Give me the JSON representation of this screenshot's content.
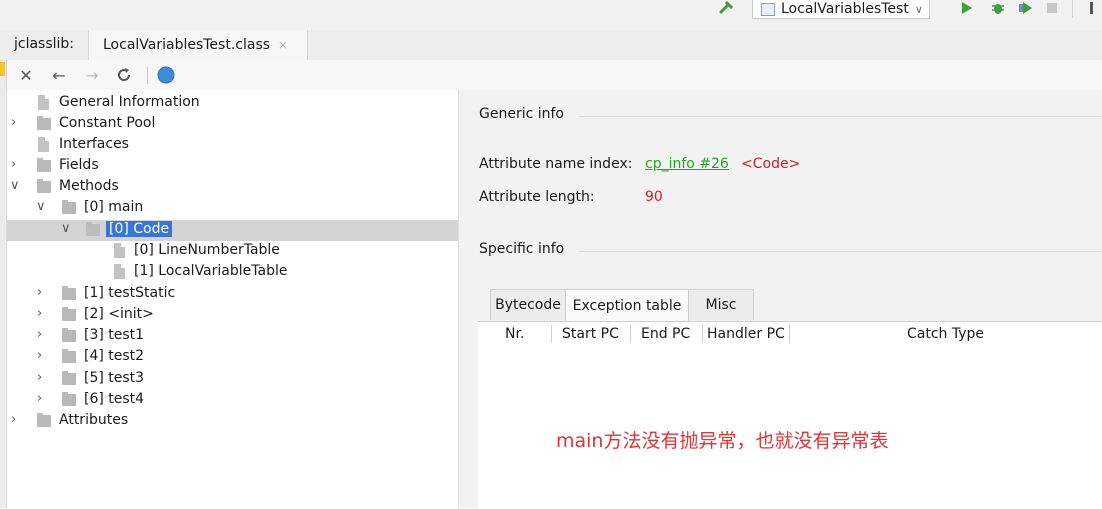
{
  "topbar": {
    "run_config": "LocalVariablesTest",
    "icons": [
      "hammer-icon",
      "run-icon",
      "debug-icon",
      "coverage-icon",
      "stop-icon"
    ]
  },
  "editor_tabs": {
    "tool_label": "jclasslib:",
    "active_tab": "LocalVariablesTest.class",
    "close_glyph": "×"
  },
  "toolbar": {
    "icons": [
      "close-icon",
      "back-icon",
      "forward-icon",
      "refresh-icon",
      "web-icon"
    ]
  },
  "tree": {
    "items": [
      {
        "label": "General Information",
        "kind": "doc",
        "depth": 0,
        "arrow": ""
      },
      {
        "label": "Constant Pool",
        "kind": "folder",
        "depth": 0,
        "arrow": ">"
      },
      {
        "label": "Interfaces",
        "kind": "doc",
        "depth": 0,
        "arrow": ""
      },
      {
        "label": "Fields",
        "kind": "folder",
        "depth": 0,
        "arrow": ">"
      },
      {
        "label": "Methods",
        "kind": "folder",
        "depth": 0,
        "arrow": "v"
      },
      {
        "label": "[0] main",
        "kind": "folder",
        "depth": 1,
        "arrow": "v"
      },
      {
        "label": "[0] Code",
        "kind": "folder",
        "depth": 2,
        "arrow": "v",
        "selected": true
      },
      {
        "label": "[0] LineNumberTable",
        "kind": "doc",
        "depth": 3,
        "arrow": ""
      },
      {
        "label": "[1] LocalVariableTable",
        "kind": "doc",
        "depth": 3,
        "arrow": ""
      },
      {
        "label": "[1] testStatic",
        "kind": "folder",
        "depth": 1,
        "arrow": ">"
      },
      {
        "label": "[2] <init>",
        "kind": "folder",
        "depth": 1,
        "arrow": ">"
      },
      {
        "label": "[3] test1",
        "kind": "folder",
        "depth": 1,
        "arrow": ">"
      },
      {
        "label": "[4] test2",
        "kind": "folder",
        "depth": 1,
        "arrow": ">"
      },
      {
        "label": "[5] test3",
        "kind": "folder",
        "depth": 1,
        "arrow": ">"
      },
      {
        "label": "[6] test4",
        "kind": "folder",
        "depth": 1,
        "arrow": ">"
      },
      {
        "label": "Attributes",
        "kind": "folder",
        "depth": 0,
        "arrow": ">"
      }
    ]
  },
  "detail": {
    "generic_title": "Generic info",
    "attr_name_label": "Attribute name index:",
    "attr_name_link": "cp_info #26",
    "attr_name_value": "<Code>",
    "attr_length_label": "Attribute length:",
    "attr_length_value": "90",
    "specific_title": "Specific info",
    "tabs": [
      "Bytecode",
      "Exception table",
      "Misc"
    ],
    "active_tab": "Exception table",
    "columns": [
      "Nr.",
      "Start PC",
      "End PC",
      "Handler PC",
      "Catch Type"
    ],
    "note": "main方法没有抛异常，也就没有异常表"
  },
  "colors": {
    "link": "#23a623",
    "value_red": "#cc1f1f",
    "note_red": "#e03535",
    "selection": "#d4d4d4"
  }
}
